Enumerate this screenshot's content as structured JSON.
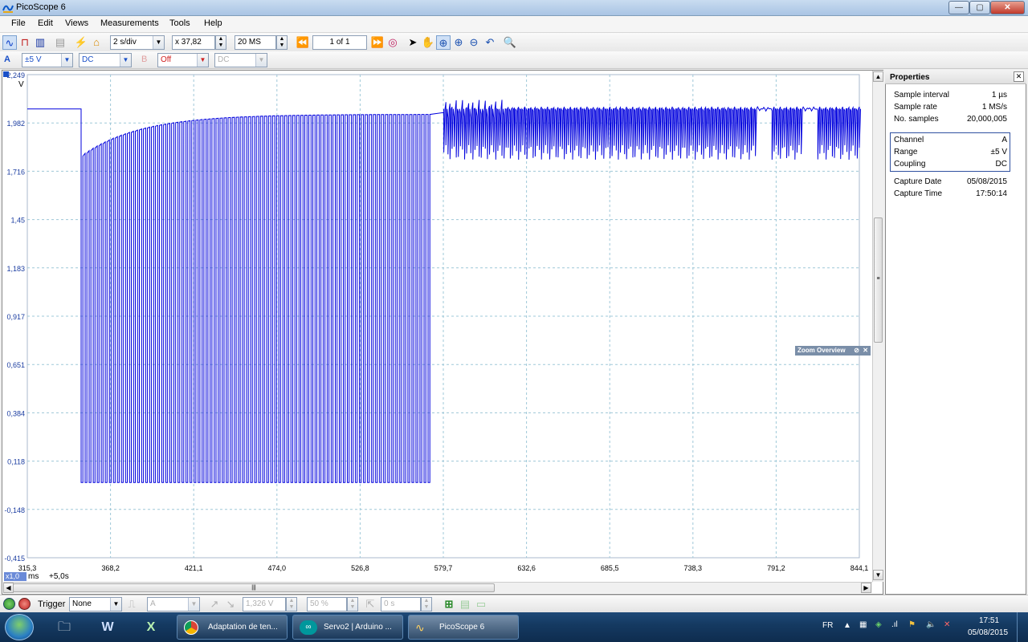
{
  "window": {
    "title": "PicoScope 6",
    "controls": {
      "minimize": "—",
      "maximize": "▢",
      "close": "✕"
    }
  },
  "menu": [
    "File",
    "Edit",
    "Views",
    "Measurements",
    "Tools",
    "Help"
  ],
  "toolbar1": {
    "timebase": "2 s/div",
    "zoom": "x 37,82",
    "samples": "20 MS",
    "page": "1 of 1"
  },
  "toolbar2": {
    "channel_a_label": "A",
    "channel_a_range": "±5 V",
    "channel_a_coupling": "DC",
    "channel_b_label": "B",
    "channel_b_range": "Off",
    "channel_b_coupling": "DC"
  },
  "scope": {
    "y_unit": "V",
    "x_unit": "ms",
    "zoom_indicator": "x1,0",
    "offset_label": "+5,0s",
    "zoom_overview_label": "Zoom Overview"
  },
  "chart_data": {
    "type": "line",
    "ylabel": "V",
    "xlabel": "ms",
    "y_ticks": [
      "2,249",
      "1,982",
      "1,716",
      "1,45",
      "1,183",
      "0,917",
      "0,651",
      "0,384",
      "0,118",
      "-0,148",
      "-0,415"
    ],
    "x_ticks": [
      "315,3",
      "368,2",
      "421,1",
      "474,0",
      "526,8",
      "579,7",
      "632,6",
      "685,5",
      "738,3",
      "791,2",
      "844,1"
    ],
    "ylim": [
      -0.415,
      2.249
    ],
    "xlim": [
      315.3,
      844.1
    ],
    "grid": true,
    "color": "#0000dd",
    "series": [
      {
        "segment": "idle high",
        "x": [
          315.3,
          349.5
        ],
        "y": [
          2.06,
          2.06
        ]
      },
      {
        "segment": "pulse train, baseline recovering",
        "x_start": 349.5,
        "x_end": 570.0,
        "high_start": 1.8,
        "high_end": 2.03,
        "low": 0.0
      },
      {
        "segment": "noisy high with shallow dips",
        "x_start": 580.0,
        "x_end": 844.1,
        "high": 2.06,
        "dip_low": 1.82
      }
    ]
  },
  "properties": {
    "title": "Properties",
    "rows_top": [
      {
        "label": "Sample interval",
        "value": "1 µs"
      },
      {
        "label": "Sample rate",
        "value": "1 MS/s"
      },
      {
        "label": "No. samples",
        "value": "20,000,005"
      }
    ],
    "rows_channel": [
      {
        "label": "Channel",
        "value": "A"
      },
      {
        "label": "Range",
        "value": "±5 V"
      },
      {
        "label": "Coupling",
        "value": "DC"
      }
    ],
    "rows_capture": [
      {
        "label": "Capture Date",
        "value": "05/08/2015"
      },
      {
        "label": "Capture Time",
        "value": "17:50:14"
      }
    ]
  },
  "trigger": {
    "label": "Trigger",
    "mode": "None",
    "source": "A",
    "threshold": "1,326 V",
    "pretrigger": "50 %",
    "delay": "0 s"
  },
  "taskbar": {
    "tasks": [
      "Adaptation de ten...",
      "Servo2 | Arduino ...",
      "PicoScope 6"
    ],
    "lang": "FR",
    "time": "17:51",
    "date": "05/08/2015"
  }
}
